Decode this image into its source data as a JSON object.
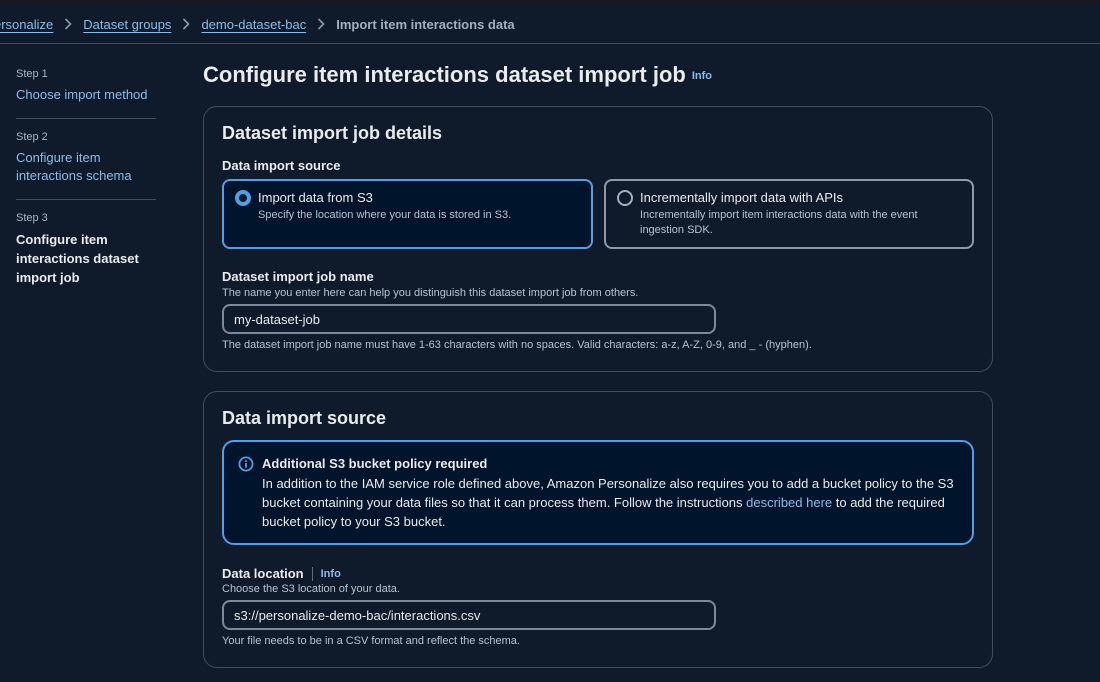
{
  "breadcrumb": {
    "items": [
      "ersonalize",
      "Dataset groups",
      "demo-dataset-bac"
    ],
    "current": "Import item interactions data"
  },
  "steps": [
    {
      "num": "Step 1",
      "title_lines": [
        "Choose import method"
      ]
    },
    {
      "num": "Step 2",
      "title_lines": [
        "Configure item",
        "interactions schema"
      ]
    },
    {
      "num": "Step 3",
      "title_lines": [
        "Configure item",
        "interactions dataset",
        "import job"
      ]
    }
  ],
  "page": {
    "title": "Configure item interactions dataset import job",
    "info": "Info"
  },
  "details": {
    "title": "Dataset import job details",
    "source_label": "Data import source",
    "options": [
      {
        "label": "Import data from S3",
        "desc_lines": [
          "Specify the location where your data is stored in S3."
        ],
        "selected": true
      },
      {
        "label": "Incrementally import data with APIs",
        "desc_lines": [
          "Incrementally import item interactions data with the event",
          "ingestion SDK."
        ],
        "selected": false
      }
    ],
    "job_name_label": "Dataset import job name",
    "job_name_desc": "The name you enter here can help you distinguish this dataset import job from others.",
    "job_name_value": "my-dataset-job",
    "job_name_constraint": "The dataset import job name must have 1-63 characters with no spaces. Valid characters: a-z, A-Z, 0-9, and _ - (hyphen)."
  },
  "source": {
    "title": "Data import source",
    "alert": {
      "title": "Additional S3 bucket policy required",
      "body_1": "In addition to the IAM service role defined above, Amazon Personalize also requires you to add a bucket policy to the S3 bucket containing your data files so that it can process them. Follow the instructions ",
      "link": "described here",
      "body_2": " to add the required bucket policy to your S3 bucket."
    },
    "location_label": "Data location",
    "location_info": "Info",
    "location_desc": "Choose the S3 location of your data.",
    "location_value": "s3://personalize-demo-bac/interactions.csv",
    "location_constraint": "Your file needs to be in a CSV format and reflect the schema."
  }
}
